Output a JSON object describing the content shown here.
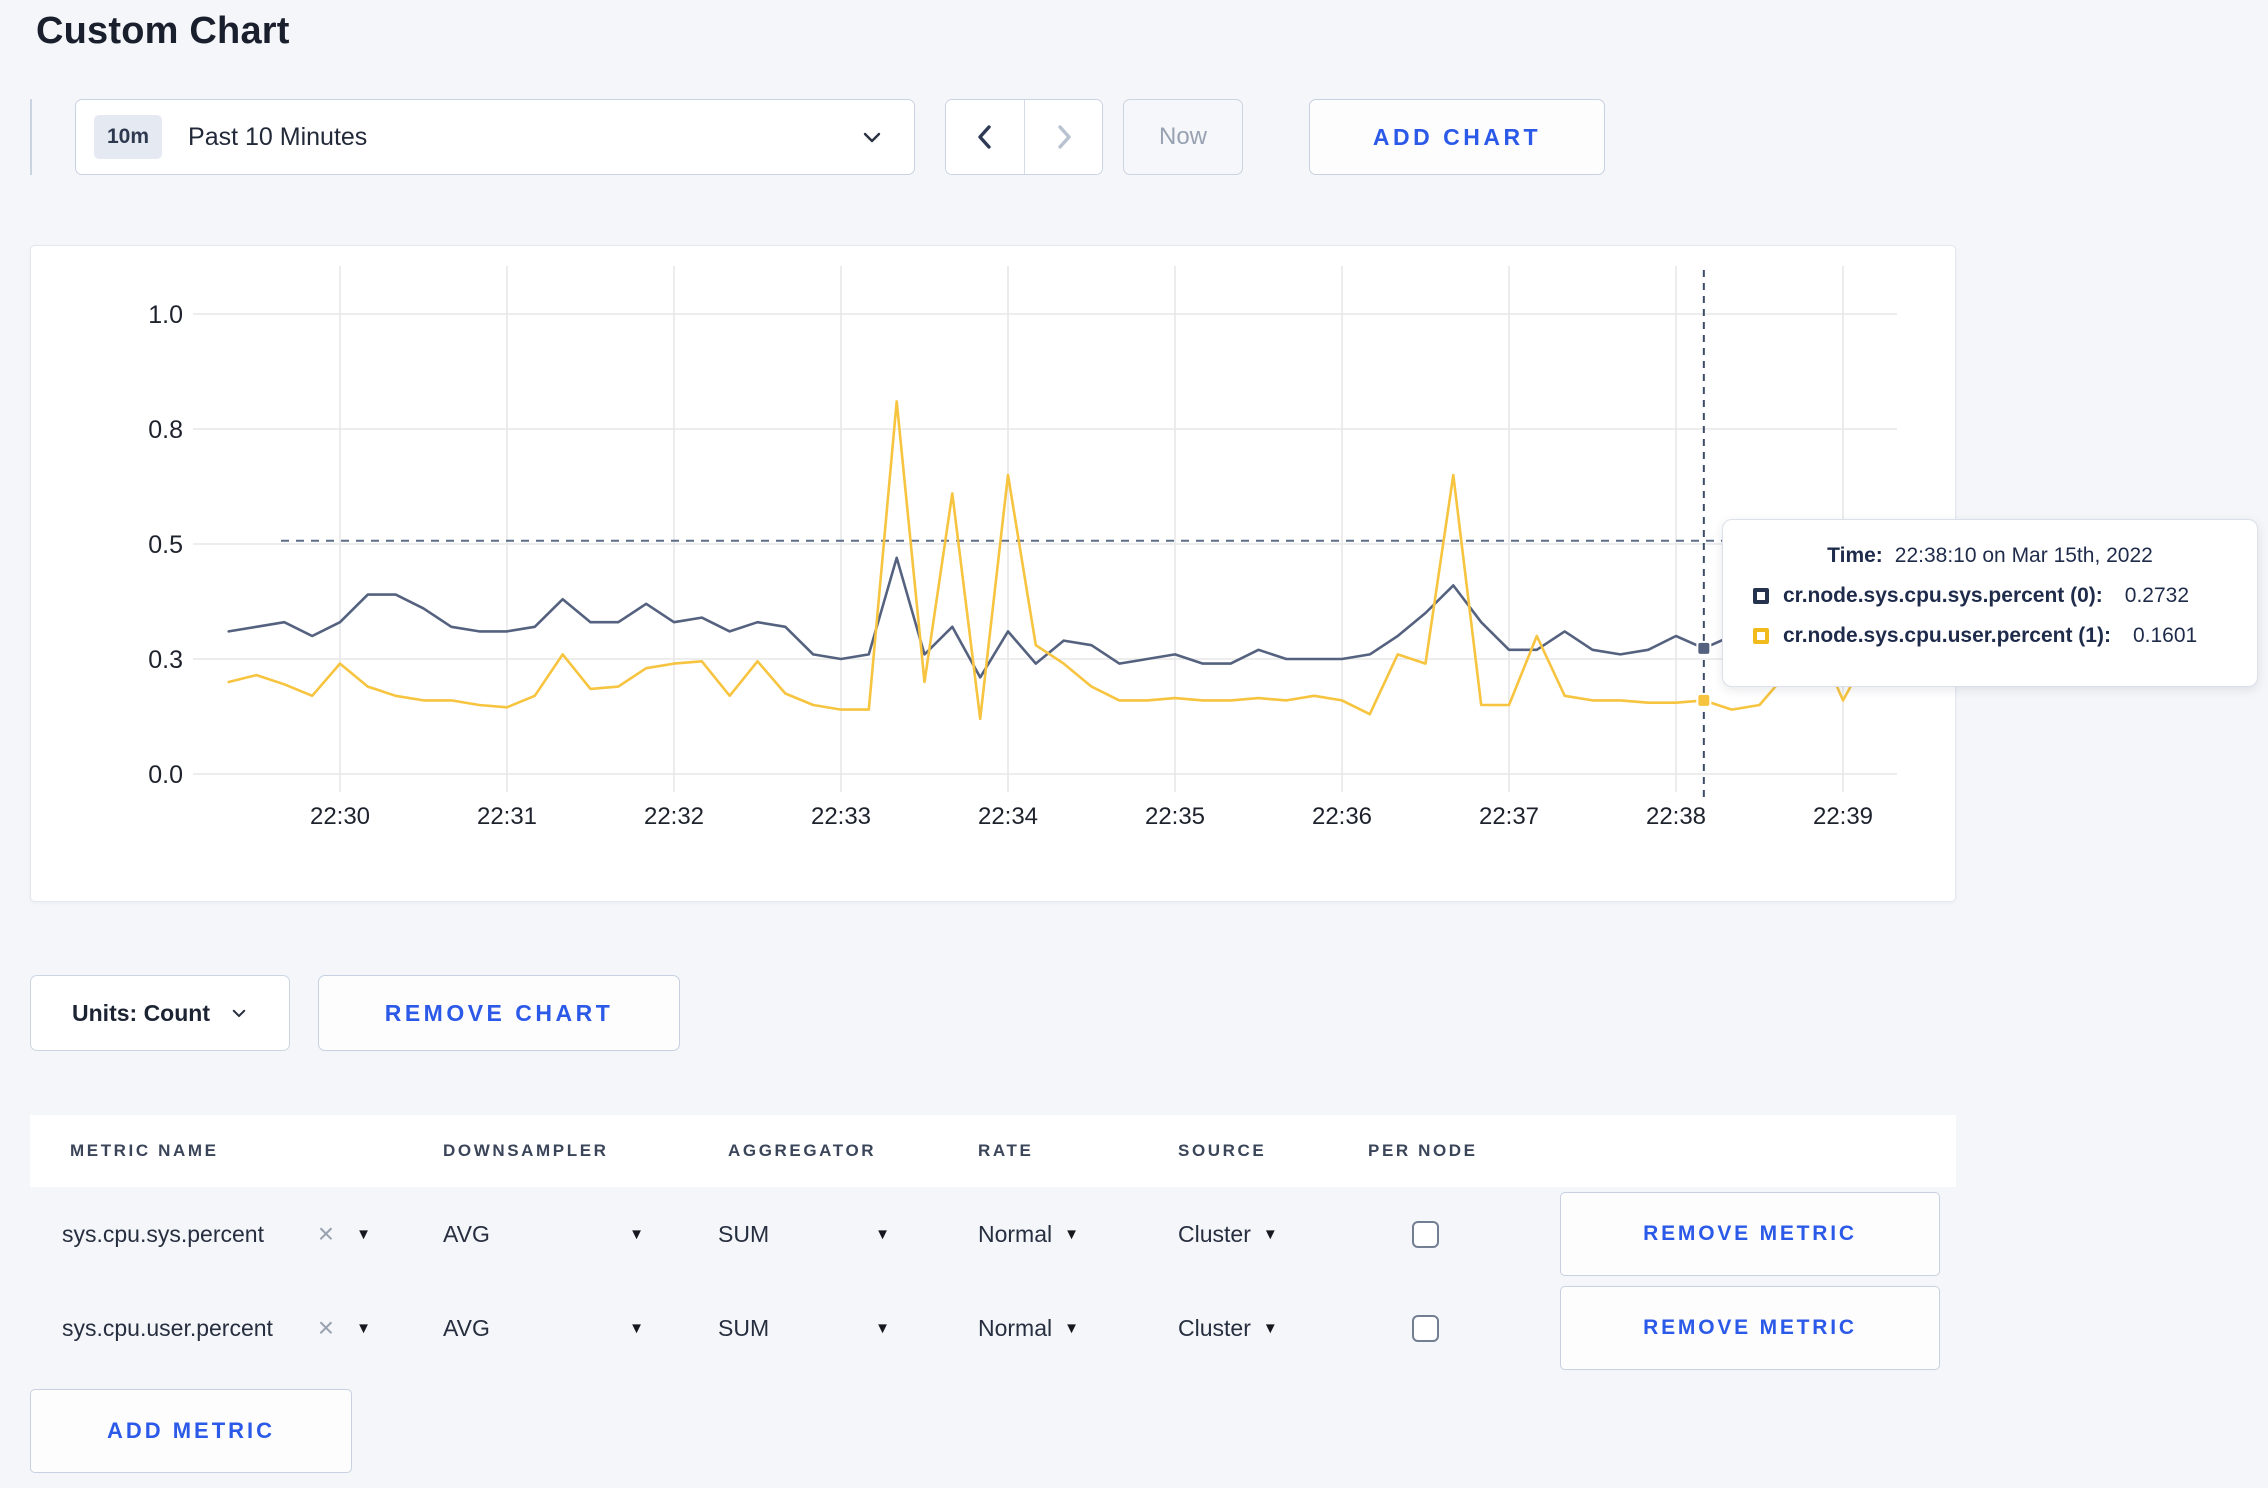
{
  "page": {
    "title": "Custom Chart"
  },
  "toolbar": {
    "time_window_badge": "10m",
    "time_window_label": "Past 10 Minutes",
    "now_label": "Now",
    "add_chart_label": "ADD CHART"
  },
  "chart_data": {
    "type": "line",
    "title": "",
    "xlabel": "",
    "ylabel": "",
    "ylim": [
      0,
      1
    ],
    "grid": true,
    "legend_position": "tooltip-overlay",
    "x_start": "22:29:20",
    "x_interval_seconds": 10,
    "x_first_tick_index": 4,
    "x_tick_labels": [
      "22:30",
      "22:31",
      "22:32",
      "22:33",
      "22:34",
      "22:35",
      "22:36",
      "22:37",
      "22:38",
      "22:39"
    ],
    "y_tick_labels": [
      "0.0",
      "0.3",
      "0.5",
      "0.8",
      "1.0"
    ],
    "y_tick_values": [
      0,
      0.25,
      0.5,
      0.75,
      1.0
    ],
    "series": [
      {
        "name": "cr.node.sys.cpu.sys.percent",
        "color": "#55627f",
        "values": [
          0.31,
          0.32,
          0.33,
          0.3,
          0.33,
          0.39,
          0.39,
          0.36,
          0.32,
          0.31,
          0.31,
          0.32,
          0.38,
          0.33,
          0.33,
          0.37,
          0.33,
          0.34,
          0.31,
          0.33,
          0.32,
          0.26,
          0.25,
          0.26,
          0.47,
          0.26,
          0.32,
          0.21,
          0.31,
          0.24,
          0.29,
          0.28,
          0.24,
          0.25,
          0.26,
          0.24,
          0.24,
          0.27,
          0.25,
          0.25,
          0.25,
          0.26,
          0.3,
          0.35,
          0.41,
          0.33,
          0.27,
          0.27,
          0.31,
          0.27,
          0.26,
          0.27,
          0.3,
          0.2732,
          0.3,
          0.27,
          0.29,
          0.3,
          0.29,
          0.3
        ]
      },
      {
        "name": "cr.node.sys.cpu.user.percent",
        "color": "#f7c440",
        "values": [
          0.2,
          0.215,
          0.195,
          0.17,
          0.24,
          0.19,
          0.17,
          0.16,
          0.16,
          0.15,
          0.145,
          0.17,
          0.26,
          0.185,
          0.19,
          0.23,
          0.24,
          0.245,
          0.17,
          0.245,
          0.175,
          0.15,
          0.14,
          0.14,
          0.81,
          0.2,
          0.61,
          0.12,
          0.65,
          0.28,
          0.24,
          0.19,
          0.16,
          0.16,
          0.165,
          0.16,
          0.16,
          0.165,
          0.16,
          0.17,
          0.16,
          0.13,
          0.26,
          0.24,
          0.65,
          0.15,
          0.15,
          0.3,
          0.17,
          0.16,
          0.16,
          0.155,
          0.155,
          0.1601,
          0.14,
          0.15,
          0.22,
          0.3,
          0.16,
          0.27
        ]
      }
    ],
    "crosshair": {
      "time": "22:38:10",
      "x_index": 53,
      "y_guide": 0.507,
      "values": [
        0.2732,
        0.1601
      ]
    }
  },
  "tooltip": {
    "time_label": "Time:",
    "time_value": "22:38:10 on Mar 15th, 2022",
    "series": [
      {
        "name": "cr.node.sys.cpu.sys.percent (0):",
        "value": "0.2732",
        "color": "#26334f"
      },
      {
        "name": "cr.node.sys.cpu.user.percent (1):",
        "value": "0.1601",
        "color": "#f2bb1d"
      }
    ]
  },
  "chart_controls": {
    "units_label": "Units: Count",
    "remove_chart_label": "REMOVE CHART"
  },
  "metrics_table": {
    "headers": [
      "METRIC NAME",
      "DOWNSAMPLER",
      "AGGREGATOR",
      "RATE",
      "SOURCE",
      "PER NODE"
    ],
    "rows": [
      {
        "metric": "sys.cpu.sys.percent",
        "downsampler": "AVG",
        "aggregator": "SUM",
        "rate": "Normal",
        "source": "Cluster",
        "per_node_checked": false,
        "remove_label": "REMOVE METRIC"
      },
      {
        "metric": "sys.cpu.user.percent",
        "downsampler": "AVG",
        "aggregator": "SUM",
        "rate": "Normal",
        "source": "Cluster",
        "per_node_checked": false,
        "remove_label": "REMOVE METRIC"
      }
    ],
    "add_metric_label": "ADD METRIC"
  }
}
